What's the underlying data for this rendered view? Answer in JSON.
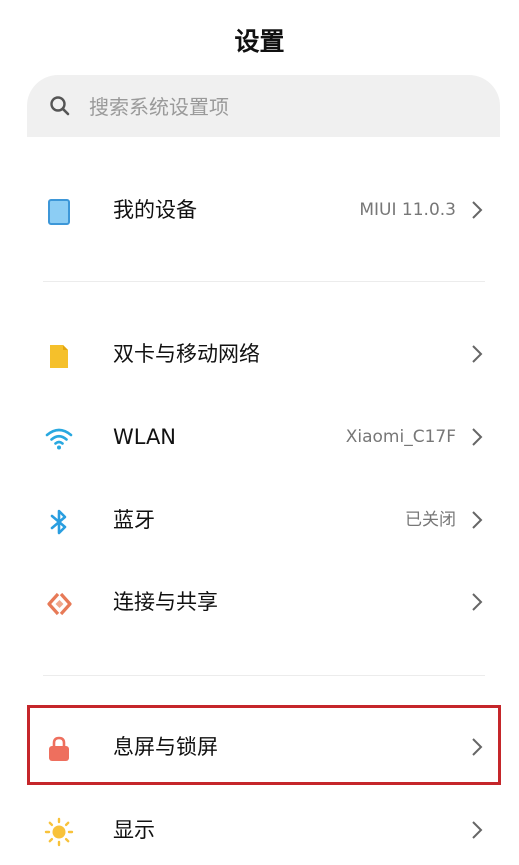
{
  "header": {
    "title": "设置"
  },
  "search": {
    "placeholder": "搜索系统设置项"
  },
  "rows": [
    {
      "label": "我的设备",
      "value": "MIUI 11.0.3",
      "icon": "tablet-icon"
    },
    {
      "label": "双卡与移动网络",
      "value": "",
      "icon": "sim-card-icon"
    },
    {
      "label": "WLAN",
      "value": "Xiaomi_C17F",
      "icon": "wifi-icon"
    },
    {
      "label": "蓝牙",
      "value": "已关闭",
      "icon": "bluetooth-icon"
    },
    {
      "label": "连接与共享",
      "value": "",
      "icon": "connection-share-icon"
    },
    {
      "label": "息屏与锁屏",
      "value": "",
      "icon": "lock-icon"
    },
    {
      "label": "显示",
      "value": "",
      "icon": "sun-icon"
    }
  ],
  "colors": {
    "tablet": "#5aaee8",
    "sim": "#f5c02b",
    "wifi": "#29a8e0",
    "bluetooth": "#2a9ee0",
    "share": "#e77a57",
    "lock": "#ee6f5e",
    "sun": "#f8c23a",
    "highlight_border": "#c5262a"
  }
}
